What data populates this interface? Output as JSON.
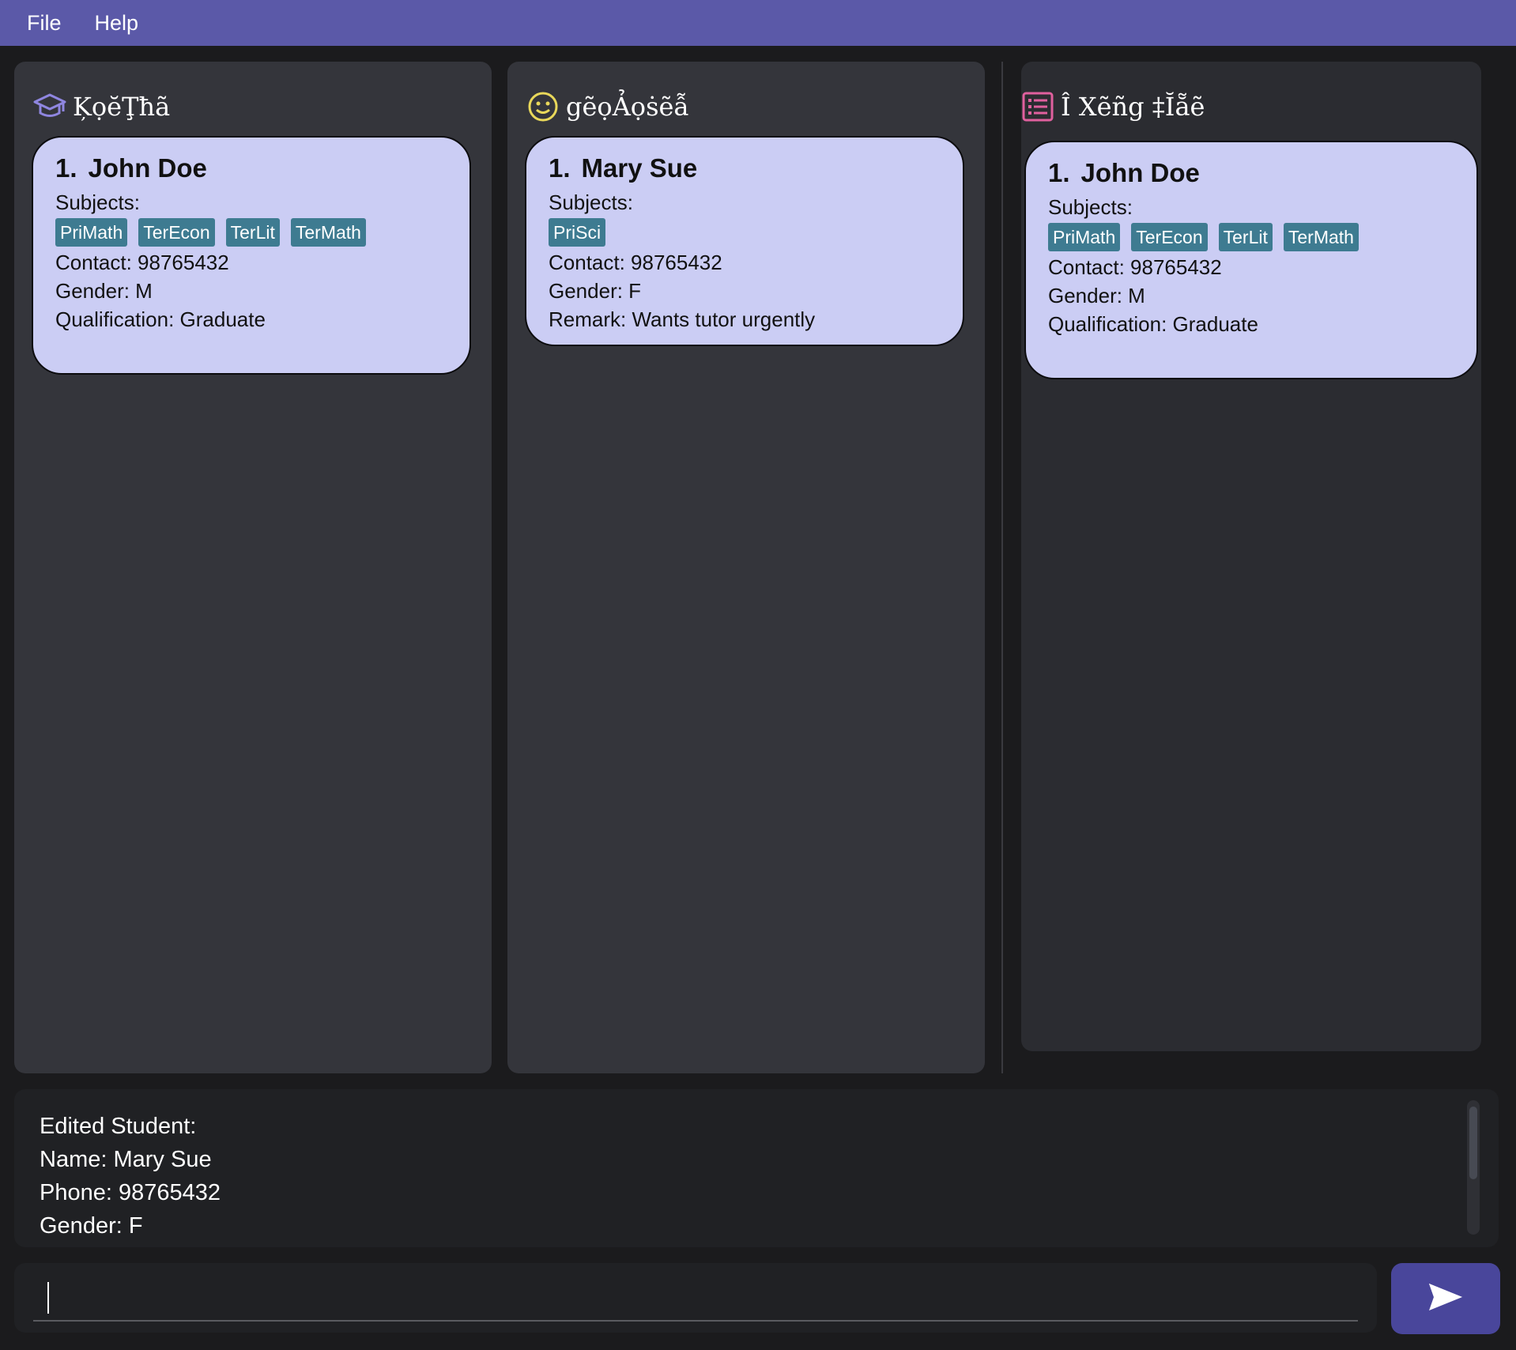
{
  "menu": {
    "file": "File",
    "help": "Help"
  },
  "panels": {
    "tutors": {
      "header": "ĶọĕŢħã",
      "icon": "graduation-cap-icon",
      "cards": [
        {
          "index": "1.",
          "name": "John Doe",
          "subjects_label": "Subjects:",
          "tags": [
            "PriMath",
            "TerEcon",
            "TerLit",
            "TerMath"
          ],
          "contact": "Contact: 98765432",
          "gender": "Gender: M",
          "extra": "Qualification: Graduate"
        }
      ]
    },
    "students": {
      "header": "gẽọẢọṡẽẫ",
      "icon": "smiley-icon",
      "cards": [
        {
          "index": "1.",
          "name": "Mary Sue",
          "subjects_label": "Subjects:",
          "tags": [
            "PriSci"
          ],
          "contact": "Contact: 98765432",
          "gender": "Gender: F",
          "extra": "Remark: Wants tutor urgently"
        }
      ]
    },
    "match": {
      "header": "Î Xẽñg ‡Ĭẵẽ",
      "icon": "list-icon",
      "cards": [
        {
          "index": "1.",
          "name": "John Doe",
          "subjects_label": "Subjects:",
          "tags": [
            "PriMath",
            "TerEcon",
            "TerLit",
            "TerMath"
          ],
          "contact": "Contact: 98765432",
          "gender": "Gender: M",
          "extra": "Qualification: Graduate"
        }
      ]
    }
  },
  "result": {
    "lines": [
      "Edited Student:",
      "Name: Mary Sue",
      "Phone: 98765432",
      "Gender: F"
    ]
  },
  "command": {
    "value": "",
    "placeholder": ""
  },
  "send_icon": "send-icon",
  "colors": {
    "menubar": "#5b59a8",
    "card": "#cbcdf4",
    "tag": "#3e7b91",
    "tutor_icon": "#8f86e0",
    "student_icon": "#e9d85a",
    "match_icon": "#e0609e",
    "send_button": "#49469b"
  }
}
